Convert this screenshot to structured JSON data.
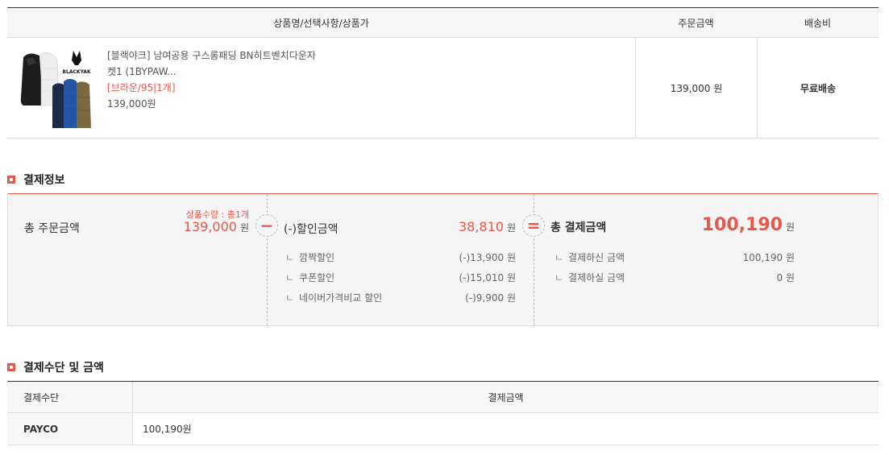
{
  "order_table": {
    "headers": [
      "상품명/선택사항/상품가",
      "주문금액",
      "배송비"
    ],
    "item": {
      "name": "[블랙야크] 남여공용 구스롱패딩 BN히트벤치다운자켓1 (1BYPAW...",
      "option": "[브라운/95|1개]",
      "unit_price": "139,000원",
      "order_amount": "139,000 원",
      "shipping": "무료배송",
      "brand_logo_text": "BLACKYAK"
    }
  },
  "payment_info": {
    "title": "결제정보",
    "total_order_label": "총 주문금액",
    "quantity_text": "상품수량 : 총1개",
    "total_order_amount": "139,000",
    "discount_label": "(-)할인금액",
    "discount_amount": "38,810",
    "discount_items": [
      {
        "label": "깜짝할인",
        "amount": "(-)13,900 원"
      },
      {
        "label": "쿠폰할인",
        "amount": "(-)15,010 원"
      },
      {
        "label": "네이버가격비교 할인",
        "amount": "(-)9,900 원"
      }
    ],
    "final_label": "총 결제금액",
    "final_amount": "100,190",
    "final_items": [
      {
        "label": "결제하신 금액",
        "amount": "100,190 원"
      },
      {
        "label": "결제하실 금액",
        "amount": "0 원"
      }
    ],
    "won": "원",
    "sub_marker": "ㄴ",
    "minus_symbol": "−",
    "equal_symbol": "="
  },
  "payment_method": {
    "title": "결제수단 및 금액",
    "headers": [
      "결제수단",
      "결제금액"
    ],
    "rows": [
      {
        "method": "PAYCO",
        "amount": "100,190원"
      }
    ]
  },
  "colors": {
    "accent": "#e8574a",
    "border": "#dddddd",
    "panel_bg": "#f5f5f5"
  }
}
